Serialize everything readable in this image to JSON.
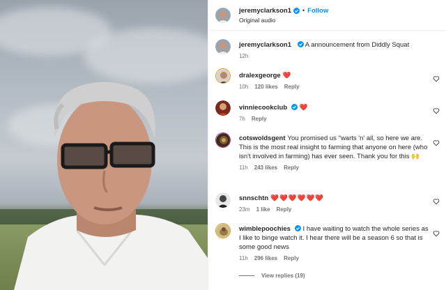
{
  "post": {
    "username": "jeremyclarkson1",
    "follow_label": "Follow",
    "audio_label": "Original audio",
    "separator": "•"
  },
  "caption": {
    "username": "jeremyclarkson1",
    "text": "A announcement from Diddly Squat",
    "time": "12h"
  },
  "comments": [
    {
      "username": "dralexgeorge",
      "text": "❤️",
      "time": "10h",
      "likes": "120 likes",
      "reply": "Reply"
    },
    {
      "username": "vinniecookclub",
      "text": "❤️",
      "time": "7h",
      "likes": "",
      "reply": "Reply"
    },
    {
      "username": "cotswoldsgent",
      "text": "You promised us \"warts 'n' all, so here we are. This is the most real insight to farming that anyone on here (who isn't involved in farming) has ever seen. Thank you for this 🙌",
      "time": "11h",
      "likes": "243 likes",
      "reply": "Reply"
    },
    {
      "username": "snnschtn",
      "text": "❤️❤️❤️❤️❤️❤️",
      "time": "23m",
      "likes": "1 like",
      "reply": "Reply"
    },
    {
      "username": "wimblepoochies",
      "text": "I have waiting to watch the whole series as I like to binge watch it. I hear there will be a season 6 so that is some good news",
      "time": "11h",
      "likes": "296 likes",
      "reply": "Reply"
    }
  ],
  "view_replies": "View replies (19)",
  "colors": {
    "accent": "#0095f6",
    "heart": "#ed4956",
    "verified": "#0095f6"
  },
  "icons": [
    "verified-badge-icon",
    "heart-outline-icon"
  ]
}
